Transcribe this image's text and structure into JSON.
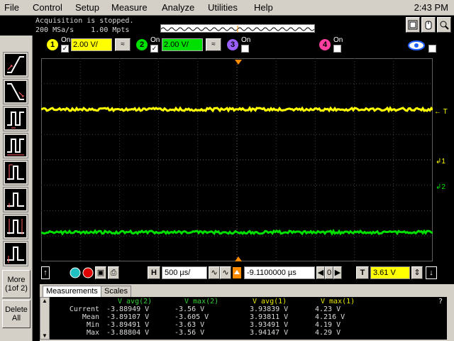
{
  "menu": {
    "items": [
      "File",
      "Control",
      "Setup",
      "Measure",
      "Analyze",
      "Utilities",
      "Help"
    ],
    "clock": "2:43 PM"
  },
  "status": {
    "line1": "Acquisition is stopped.",
    "line2": "200 MSa/s    1.00 Mpts"
  },
  "channels": [
    {
      "num": "1",
      "on_label": "On",
      "checked": true,
      "scale": "2.00 V/",
      "color": "#ffff00"
    },
    {
      "num": "2",
      "on_label": "On",
      "checked": true,
      "scale": "2.00 V/",
      "color": "#00e000"
    },
    {
      "num": "3",
      "on_label": "On",
      "checked": false,
      "color": "#9a60ff"
    },
    {
      "num": "4",
      "on_label": "On",
      "checked": false,
      "color": "#ff40a0"
    }
  ],
  "left_toolbar": {
    "more_label": "More",
    "more_sub": "(1of 2)",
    "delete_label": "Delete",
    "delete_sub": "All"
  },
  "markers": {
    "trigger": "T",
    "ch1": "1",
    "ch2": "2"
  },
  "timebase": {
    "h_label": "H",
    "time_per_div": "500 µs/",
    "delay": "-9.1100000 µs",
    "delay_digit": "0",
    "trigger_label": "T",
    "trigger_level": "3.61 V"
  },
  "measurements": {
    "tabs": [
      "Measurements",
      "Scales"
    ],
    "headers": [
      "V avg(2)",
      "V max(2)",
      "V avg(1)",
      "V max(1)"
    ],
    "help": "?",
    "rows": [
      {
        "label": "Current",
        "values": [
          "-3.88949 V",
          "-3.56 V",
          "3.93839 V",
          "4.23 V"
        ]
      },
      {
        "label": "Mean",
        "values": [
          "-3.89107 V",
          "-3.605 V",
          "3.93811 V",
          "4.216 V"
        ]
      },
      {
        "label": "Min",
        "values": [
          "-3.89491 V",
          "-3.63 V",
          "3.93491 V",
          "4.19 V"
        ]
      },
      {
        "label": "Max",
        "values": [
          "-3.88804 V",
          "-3.56 V",
          "3.94147 V",
          "4.29 V"
        ]
      }
    ]
  },
  "colors": {
    "ch1": "#ffff00",
    "ch2": "#00e000",
    "accent_orange": "#ff8c00"
  }
}
